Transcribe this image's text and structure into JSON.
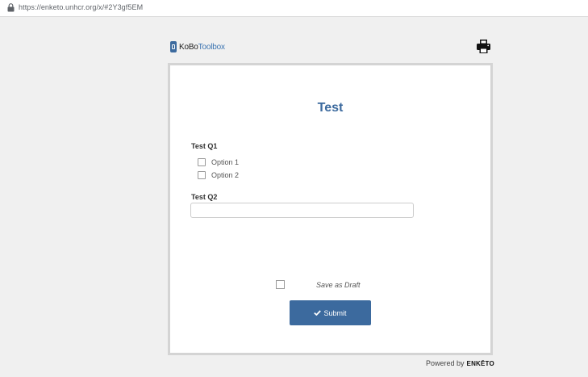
{
  "browser": {
    "url": "https://enketo.unhcr.org/x/#2Y3gf5EM"
  },
  "header": {
    "logo_k": "KoBo",
    "logo_t": "Toolbox",
    "print_icon": "printer-icon"
  },
  "form": {
    "title": "Test",
    "q1": {
      "label": "Test Q1",
      "options": [
        "Option 1",
        "Option 2"
      ]
    },
    "q2": {
      "label": "Test Q2",
      "value": ""
    },
    "save_draft_label": "Save as Draft",
    "submit_label": "Submit"
  },
  "footer": {
    "powered_by": "Powered by",
    "brand": "ENKĒTO"
  },
  "colors": {
    "accent": "#3c6a9e",
    "background": "#f0f0f0"
  }
}
